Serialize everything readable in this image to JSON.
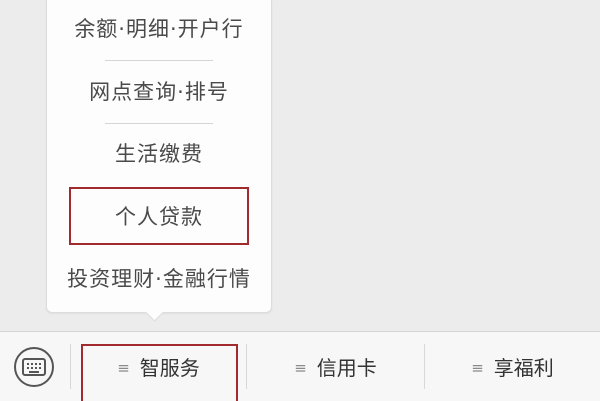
{
  "popup_menu": {
    "items": [
      {
        "label": "余额·明细·开户行"
      },
      {
        "label": "网点查询·排号"
      },
      {
        "label": "生活缴费"
      },
      {
        "label": "个人贷款"
      },
      {
        "label": "投资理财·金融行情"
      }
    ],
    "highlighted_item": "个人贷款"
  },
  "bottom_bar": {
    "keyboard_icon": "keyboard-icon",
    "tabs": [
      {
        "label": "智服务",
        "icon": "menu-lines-icon"
      },
      {
        "label": "信用卡",
        "icon": "menu-lines-icon"
      },
      {
        "label": "享福利",
        "icon": "menu-lines-icon"
      }
    ],
    "highlighted_tab": "智服务"
  },
  "colors": {
    "highlight": "#a12a2e",
    "background": "#ececec",
    "popup_background": "#fdfdfd",
    "text": "#4a4a4a"
  }
}
